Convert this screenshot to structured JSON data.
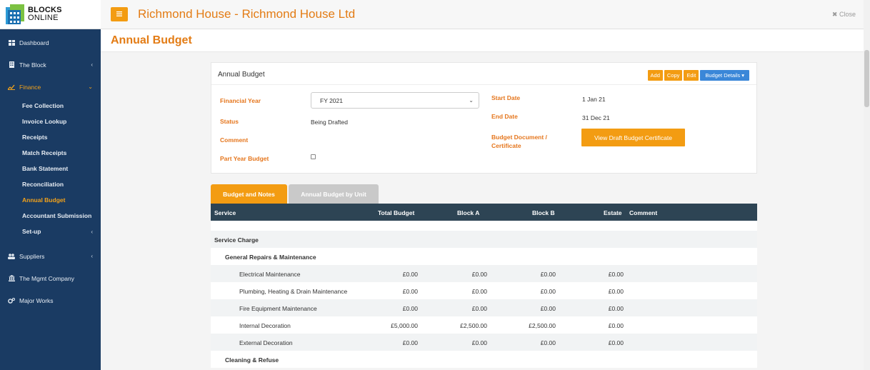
{
  "logo": {
    "line1": "BLOCKS",
    "line2": "ONLINE"
  },
  "sidebar": {
    "items": [
      {
        "label": "Dashboard"
      },
      {
        "label": "The Block"
      },
      {
        "label": "Finance"
      },
      {
        "label": "Suppliers"
      },
      {
        "label": "The Mgmt Company"
      },
      {
        "label": "Major Works"
      }
    ],
    "finance_sub": [
      {
        "label": "Fee Collection"
      },
      {
        "label": "Invoice Lookup"
      },
      {
        "label": "Receipts"
      },
      {
        "label": "Match Receipts"
      },
      {
        "label": "Bank Statement"
      },
      {
        "label": "Reconciliation"
      },
      {
        "label": "Annual Budget"
      },
      {
        "label": "Accountant Submission"
      },
      {
        "label": "Set-up"
      }
    ]
  },
  "header": {
    "title": "Richmond House - Richmond House Ltd",
    "close_label": "Close"
  },
  "page": {
    "title": "Annual Budget"
  },
  "card": {
    "title": "Annual Budget",
    "buttons": {
      "add": "Add",
      "copy": "Copy",
      "edit": "Edit",
      "details": "Budget Details ▾"
    },
    "financial_year_label": "Financial Year",
    "financial_year_value": "FY 2021",
    "status_label": "Status",
    "status_value": "Being Drafted",
    "comment_label": "Comment",
    "part_year_label": "Part Year Budget",
    "start_date_label": "Start Date",
    "start_date_value": "1 Jan 21",
    "end_date_label": "End Date",
    "end_date_value": "31 Dec 21",
    "doc_label_1": "Budget Document /",
    "doc_label_2": "Certificate",
    "cert_button": "View Draft Budget Certificate"
  },
  "tabs": [
    {
      "label": "Budget and Notes"
    },
    {
      "label": "Annual Budget by Unit"
    }
  ],
  "table": {
    "headers": {
      "service": "Service",
      "total": "Total Budget",
      "a": "Block A",
      "b": "Block B",
      "estate": "Estate",
      "comment": "Comment"
    },
    "section": "Service Charge",
    "group1": "General Repairs & Maintenance",
    "rows": [
      {
        "service": "Electrical Maintenance",
        "total": "£0.00",
        "a": "£0.00",
        "b": "£0.00",
        "estate": "£0.00"
      },
      {
        "service": "Plumbing, Heating & Drain Maintenance",
        "total": "£0.00",
        "a": "£0.00",
        "b": "£0.00",
        "estate": "£0.00"
      },
      {
        "service": "Fire Equipment Maintenance",
        "total": "£0.00",
        "a": "£0.00",
        "b": "£0.00",
        "estate": "£0.00"
      },
      {
        "service": "Internal Decoration",
        "total": "£5,000.00",
        "a": "£2,500.00",
        "b": "£2,500.00",
        "estate": "£0.00"
      },
      {
        "service": "External Decoration",
        "total": "£0.00",
        "a": "£0.00",
        "b": "£0.00",
        "estate": "£0.00"
      }
    ],
    "group2": "Cleaning & Refuse"
  },
  "colors": {
    "accent": "#f39c12",
    "title": "#e37c15",
    "sidebar": "#1a3b63",
    "table_head": "#2d4454",
    "blue_button": "#3a87d8"
  }
}
